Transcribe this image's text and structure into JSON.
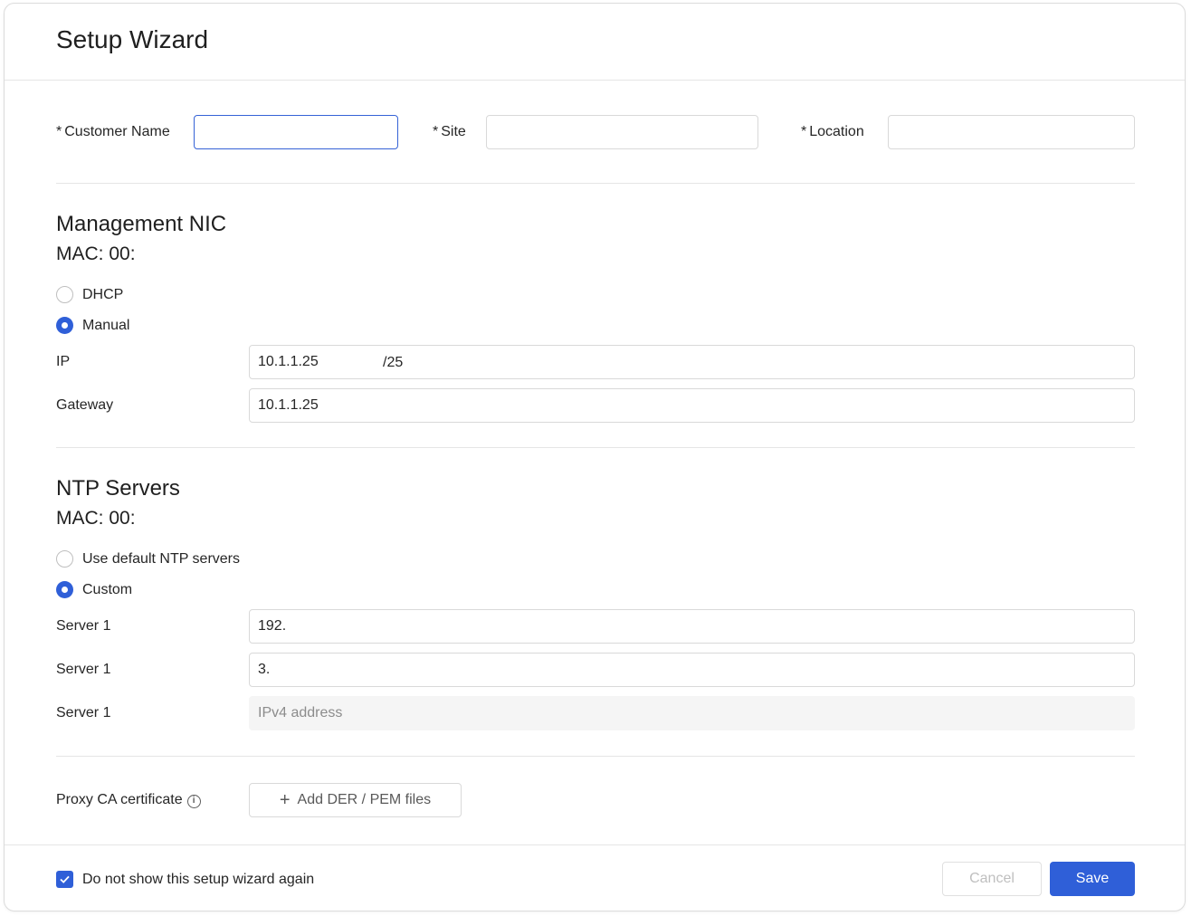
{
  "title": "Setup Wizard",
  "identity": {
    "required_mark": "*",
    "customer_name_label": "Customer Name",
    "customer_name_value": "",
    "site_label": "Site",
    "site_value": "",
    "location_label": "Location",
    "location_value": ""
  },
  "management": {
    "title": "Management NIC",
    "mac": "MAC: 00:",
    "dhcp_label": "DHCP",
    "manual_label": "Manual",
    "selected": "Manual",
    "ip_label": "IP",
    "ip_value": "10.1.1.25",
    "ip_suffix": "/25",
    "gateway_label": "Gateway",
    "gateway_value": "10.1.1.25"
  },
  "ntp": {
    "title": "NTP Servers",
    "mac": "MAC: 00:",
    "default_label": "Use default NTP servers",
    "custom_label": "Custom",
    "selected": "Custom",
    "server1_label": "Server 1",
    "server1_value": "192.",
    "server2_label": "Server 1",
    "server2_value": "3.",
    "server3_label": "Server 1",
    "server3_placeholder": "IPv4 address"
  },
  "proxy": {
    "label": "Proxy CA certificate",
    "info_icon": "info-icon",
    "info_glyph": "i",
    "add_button_icon": "plus-icon",
    "add_button_label": "Add DER / PEM files"
  },
  "footer": {
    "checkbox_label": "Do not show this setup wizard again",
    "checkbox_checked": true,
    "cancel_label": "Cancel",
    "save_label": "Save"
  },
  "colors": {
    "accent": "#2f5fd8",
    "border": "#d9d9d9",
    "disabled_bg": "#f5f5f5"
  }
}
